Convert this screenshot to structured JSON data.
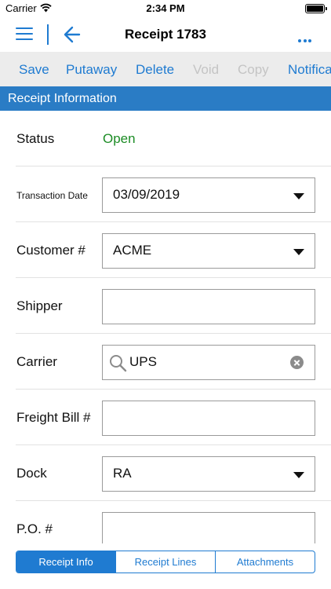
{
  "status_bar": {
    "carrier": "Carrier",
    "time": "2:34 PM"
  },
  "nav": {
    "title": "Receipt 1783"
  },
  "toolbar": [
    {
      "label": "Save",
      "enabled": true
    },
    {
      "label": "Putaway",
      "enabled": true
    },
    {
      "label": "Delete",
      "enabled": true
    },
    {
      "label": "Void",
      "enabled": false
    },
    {
      "label": "Copy",
      "enabled": false
    },
    {
      "label": "Notifica",
      "enabled": true
    }
  ],
  "section": {
    "title": "Receipt Information"
  },
  "form": {
    "status": {
      "label": "Status",
      "value": "Open"
    },
    "transaction_date": {
      "label": "Transaction Date",
      "value": "03/09/2019"
    },
    "customer": {
      "label": "Customer #",
      "value": "ACME"
    },
    "shipper": {
      "label": "Shipper",
      "value": ""
    },
    "carrier": {
      "label": "Carrier",
      "value": "UPS"
    },
    "freight_bill": {
      "label": "Freight Bill #",
      "value": ""
    },
    "dock": {
      "label": "Dock",
      "value": "RA"
    },
    "po": {
      "label": "P.O. #",
      "value": ""
    }
  },
  "tabs": [
    {
      "label": "Receipt Info",
      "active": true
    },
    {
      "label": "Receipt Lines",
      "active": false
    },
    {
      "label": "Attachments",
      "active": false
    }
  ],
  "colors": {
    "accent": "#1f7bd1",
    "header": "#2a7cc5",
    "status_open": "#1c8c25",
    "toolbar_bg": "#ececec",
    "disabled": "#c4c4c4"
  }
}
